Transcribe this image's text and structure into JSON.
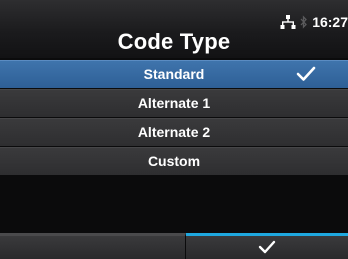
{
  "header": {
    "title": "Code Type",
    "status": {
      "network_icon": "wired-network-icon",
      "bluetooth_icon": "bluetooth-icon",
      "time": "16:27"
    }
  },
  "options": [
    {
      "label": "Standard",
      "selected": true
    },
    {
      "label": "Alternate 1",
      "selected": false
    },
    {
      "label": "Alternate 2",
      "selected": false
    },
    {
      "label": "Custom",
      "selected": false
    }
  ],
  "softkeys": {
    "left_label": "",
    "right_icon": "checkmark-icon"
  },
  "colors": {
    "selected_row": "#2e5f96",
    "row": "#333335",
    "softkey_accent": "#1fa8e0"
  }
}
